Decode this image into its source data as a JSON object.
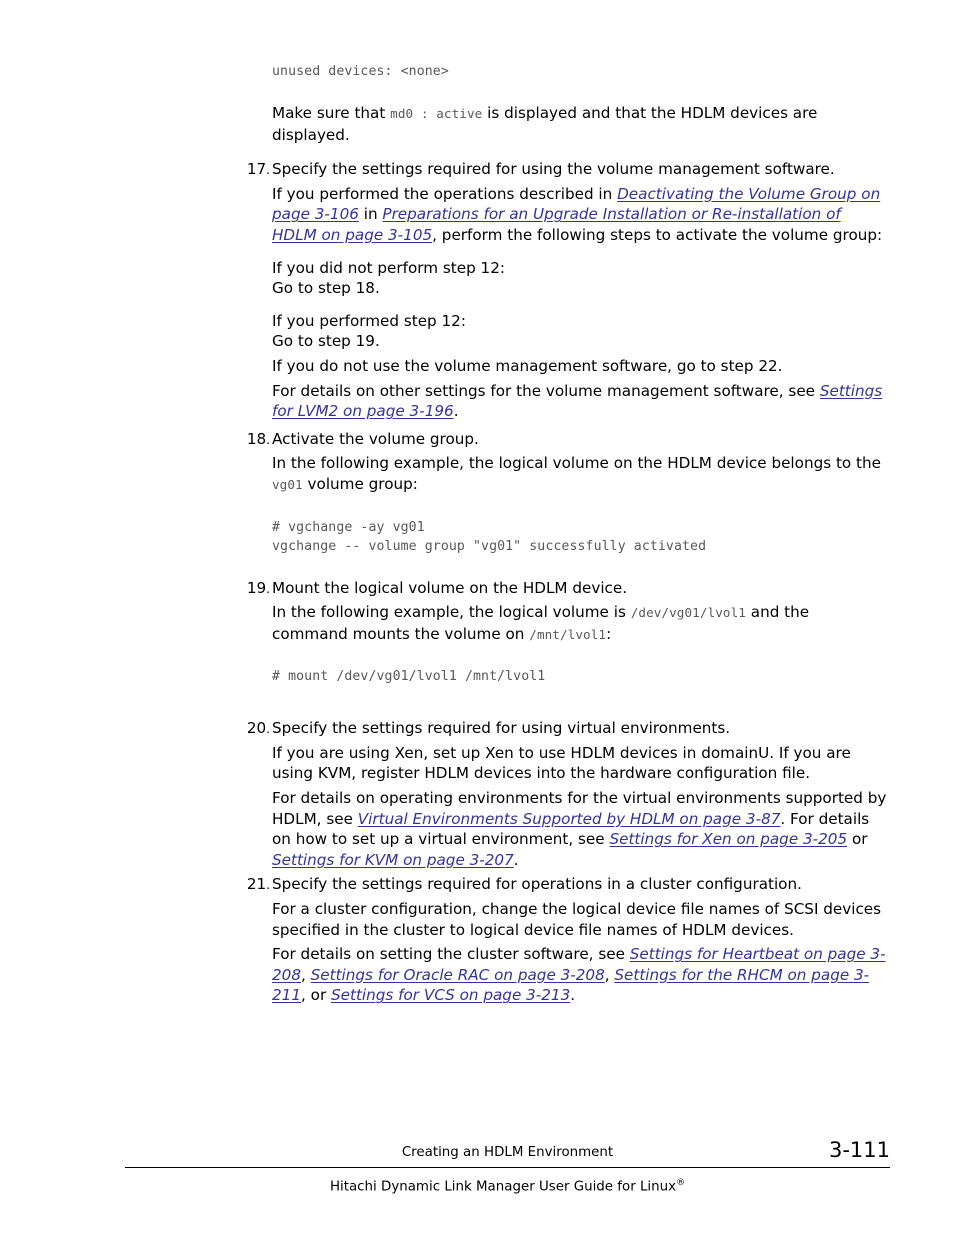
{
  "document": {
    "page_number": "3-111",
    "chapter": "Creating an HDLM Environment",
    "guide_title": "Hitachi Dynamic Link Manager User Guide for Linux",
    "guide_title_sup": "®"
  },
  "content": {
    "code_unused_devices": "unused devices: <none>",
    "make_sure": {
      "part1": "Make sure that ",
      "mono1": "md0 : active",
      "part2": " is displayed and that the HDLM devices are displayed."
    },
    "step17": {
      "number": "17",
      "dot": ".",
      "lead": "Specify the settings required for using the volume management software.",
      "p1_a": "If you performed the operations described in ",
      "p1_link1": "Deactivating the Volume Group on page 3-106",
      "p1_b": " in ",
      "p1_link2": "Preparations for an Upgrade Installation or Re-installation of HDLM on page 3-105",
      "p1_c": ", perform the following steps to activate the volume group:",
      "p2": "If you did not perform step 12:",
      "p2_sub": "Go to step 18.",
      "p3": "If you performed step 12:",
      "p3_sub": "Go to step 19.",
      "p4": "If you do not use the volume management software, go to step 22.",
      "p5_a": "For details on other settings for the volume management software, see ",
      "p5_link": "Settings for LVM2 on page 3-196",
      "p5_b": "."
    },
    "step18": {
      "number": "18",
      "dot": ".",
      "lead": "Activate the volume group.",
      "p1_a": "In the following example, the logical volume on the HDLM device belongs to the ",
      "p1_mono": "vg01",
      "p1_b": " volume group:",
      "code": "# vgchange -ay vg01\nvgchange -- volume group \"vg01\" successfully activated"
    },
    "step19": {
      "number": "19",
      "dot": ".",
      "lead": "Mount the logical volume on the HDLM device.",
      "p1_a": "In the following example, the logical volume is ",
      "p1_mono1": "/dev/vg01/lvol1",
      "p1_b": " and the command mounts the volume on ",
      "p1_mono2": "/mnt/lvol1",
      "p1_c": ":",
      "code": "# mount /dev/vg01/lvol1 /mnt/lvol1"
    },
    "step20": {
      "number": "20",
      "dot": ".",
      "lead": "Specify the settings required for using virtual environments.",
      "p1": "If you are using Xen, set up Xen to use HDLM devices in domainU. If you are using KVM, register HDLM devices into the hardware configuration file.",
      "p2_a": "For details on operating environments for the virtual environments supported by HDLM, see ",
      "p2_link1": "Virtual Environments Supported by HDLM on page 3-87",
      "p2_b": ". For details on how to set up a virtual environment, see ",
      "p2_link2": "Settings for Xen on page 3-205",
      "p2_c": " or ",
      "p2_link3": "Settings for KVM on page 3-207",
      "p2_d": "."
    },
    "step21": {
      "number": "21",
      "dot": ".",
      "lead": "Specify the settings required for operations in a cluster configuration.",
      "p1": "For a cluster configuration, change the logical device file names of SCSI devices specified in the cluster to logical device file names of HDLM devices.",
      "p2_a": "For details on setting the cluster software, see ",
      "p2_link1": "Settings for Heartbeat on page 3-208",
      "p2_b": ", ",
      "p2_link2": "Settings for Oracle RAC on page 3-208",
      "p2_c": ", ",
      "p2_link3": "Settings for the RHCM on page 3-211",
      "p2_d": ", or ",
      "p2_link4": "Settings for VCS on page 3-213",
      "p2_e": "."
    }
  },
  "colors": {
    "link": "#333399",
    "code_text": "#58585a",
    "body_text": "#000000"
  }
}
